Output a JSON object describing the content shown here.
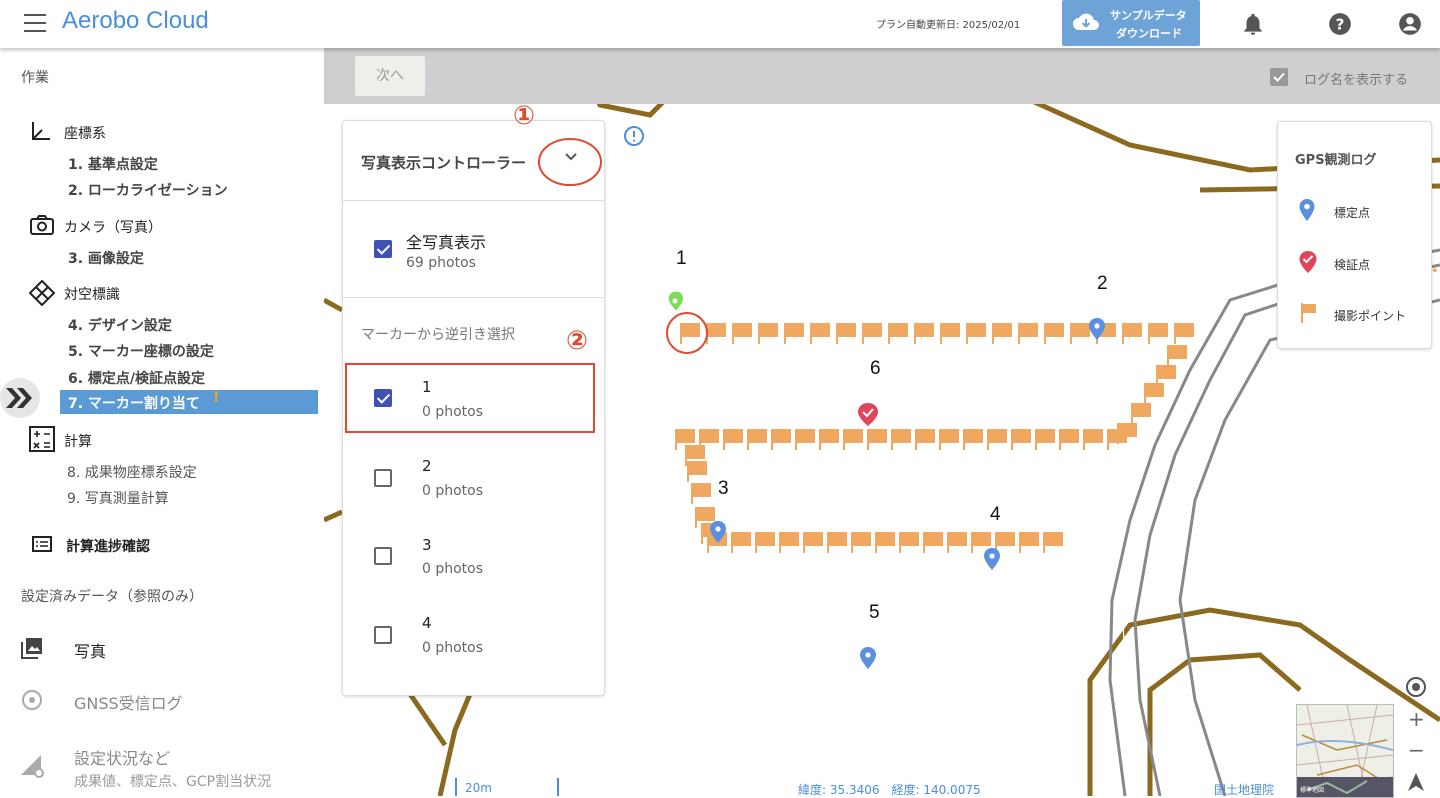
{
  "header": {
    "app_title": "Aerobo Cloud",
    "plan_update": "プラン自動更新日: 2025/02/01",
    "download_line1": "サンプルデータ",
    "download_line2": "ダウンロード"
  },
  "sidebar": {
    "section_work": "作業",
    "coordinate_system": "座標系",
    "step1": "1. 基準点設定",
    "step2": "2. ローカライゼーション",
    "camera": "カメラ（写真）",
    "step3": "3. 画像設定",
    "aerial_target": "対空標識",
    "step4": "4. デザイン設定",
    "step5": "5. マーカー座標の設定",
    "step6": "6. 標定点/検証点設定",
    "step7": "7. マーカー割り当て",
    "step7_warning": "!",
    "calculation": "計算",
    "step8": "8. 成果物座標系設定",
    "step9": "9. 写真測量計算",
    "progress_check": "計算進捗確認",
    "section_configured": "設定済みデータ（参照のみ）",
    "photos": "写真",
    "gnss_log": "GNSS受信ログ",
    "settings_status": "設定状況など",
    "settings_status_sub": "成果値、標定点、GCP割当状況"
  },
  "toolbar": {
    "next_label": "次へ",
    "show_log_names": "ログ名を表示する",
    "show_log_names_checked": true
  },
  "panel": {
    "title": "写真表示コントローラー",
    "all_photos_label": "全写真表示",
    "all_photos_count": "69 photos",
    "reverse_select_heading": "マーカーから逆引き選択",
    "markers": [
      {
        "label": "1",
        "count": "0 photos",
        "checked": true
      },
      {
        "label": "2",
        "count": "0 photos",
        "checked": false
      },
      {
        "label": "3",
        "count": "0 photos",
        "checked": false
      },
      {
        "label": "4",
        "count": "0 photos",
        "checked": false
      }
    ]
  },
  "annotations": {
    "circle1": "①",
    "circle2": "②"
  },
  "legend": {
    "title": "GPS観測ログ",
    "items": [
      {
        "label": "標定点",
        "icon": "blue-pin-icon",
        "color": "#5b8fe0"
      },
      {
        "label": "検証点",
        "icon": "red-check-pin-icon",
        "color": "#e0455c"
      },
      {
        "label": "撮影ポイント",
        "icon": "orange-flag-icon",
        "color": "#f0a860"
      }
    ]
  },
  "map": {
    "marker_labels": [
      "1",
      "2",
      "3",
      "4",
      "5",
      "6"
    ],
    "scale": "20m",
    "coords": "緯度: 35.3406　経度: 140.0075",
    "attribution": "国土地理院",
    "minimap_label": "標準地図",
    "zoom_in": "+",
    "zoom_out": "−"
  },
  "colors": {
    "accent": "#5b9bd5",
    "annotation_red": "#e04a2f",
    "road_brown": "#8b6a1f",
    "flag_orange": "#f0a860"
  }
}
